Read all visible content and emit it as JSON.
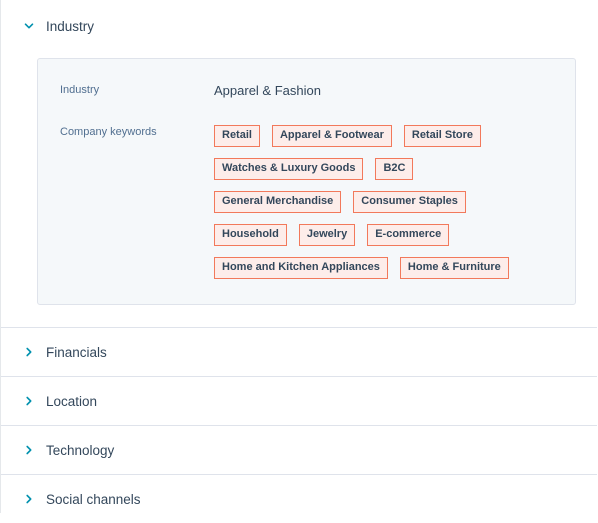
{
  "sections": [
    {
      "title": "Industry",
      "expanded": true,
      "fields": {
        "industry_label": "Industry",
        "industry_value": "Apparel & Fashion",
        "keywords_label": "Company keywords",
        "keywords": [
          "Retail",
          "Apparel & Footwear",
          "Retail Store",
          "Watches & Luxury Goods",
          "B2C",
          "General Merchandise",
          "Consumer Staples",
          "Household",
          "Jewelry",
          "E-commerce",
          "Home and Kitchen Appliances",
          "Home & Furniture"
        ]
      }
    },
    {
      "title": "Financials",
      "expanded": false
    },
    {
      "title": "Location",
      "expanded": false
    },
    {
      "title": "Technology",
      "expanded": false
    },
    {
      "title": "Social channels",
      "expanded": false
    }
  ],
  "colors": {
    "accent": "#0091ae",
    "tag_border": "#f2795b",
    "tag_background": "#fdedea",
    "card_background": "#f5f8fa"
  }
}
